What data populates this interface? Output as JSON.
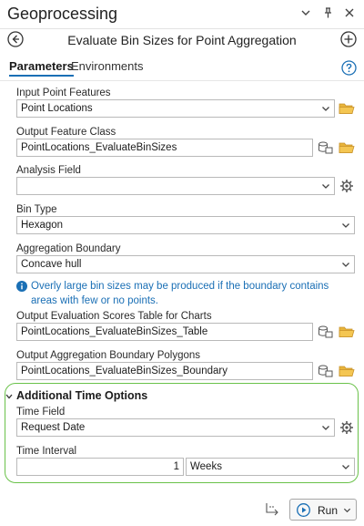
{
  "window": {
    "title": "Geoprocessing",
    "controls": [
      "⌄",
      "🖈",
      "✕"
    ]
  },
  "tool": {
    "title": "Evaluate Bin Sizes for Point Aggregation"
  },
  "tabs": {
    "parameters": "Parameters",
    "environments": "Environments"
  },
  "params": {
    "input_point_features": {
      "label": "Input Point Features",
      "value": "Point Locations"
    },
    "output_feature_class": {
      "label": "Output Feature Class",
      "value": "PointLocations_EvaluateBinSizes"
    },
    "analysis_field": {
      "label": "Analysis Field",
      "value": ""
    },
    "bin_type": {
      "label": "Bin Type",
      "value": "Hexagon"
    },
    "aggregation_boundary": {
      "label": "Aggregation Boundary",
      "value": "Concave hull"
    },
    "info_message": "Overly large bin sizes may be produced if the boundary contains areas with few or no points.",
    "output_scores_table": {
      "label": "Output Evaluation Scores Table for Charts",
      "value": "PointLocations_EvaluateBinSizes_Table"
    },
    "output_boundary_polygons": {
      "label": "Output Aggregation Boundary Polygons",
      "value": "PointLocations_EvaluateBinSizes_Boundary"
    }
  },
  "time_options": {
    "title": "Additional Time Options",
    "time_field": {
      "label": "Time Field",
      "value": "Request Date"
    },
    "time_interval": {
      "label": "Time Interval",
      "value": "1",
      "unit": "Weeks"
    }
  },
  "footer": {
    "run_label": "Run"
  },
  "colors": {
    "accent": "#1a6fb5",
    "group_border": "#6ac24a",
    "folder": "#e8b43a"
  }
}
